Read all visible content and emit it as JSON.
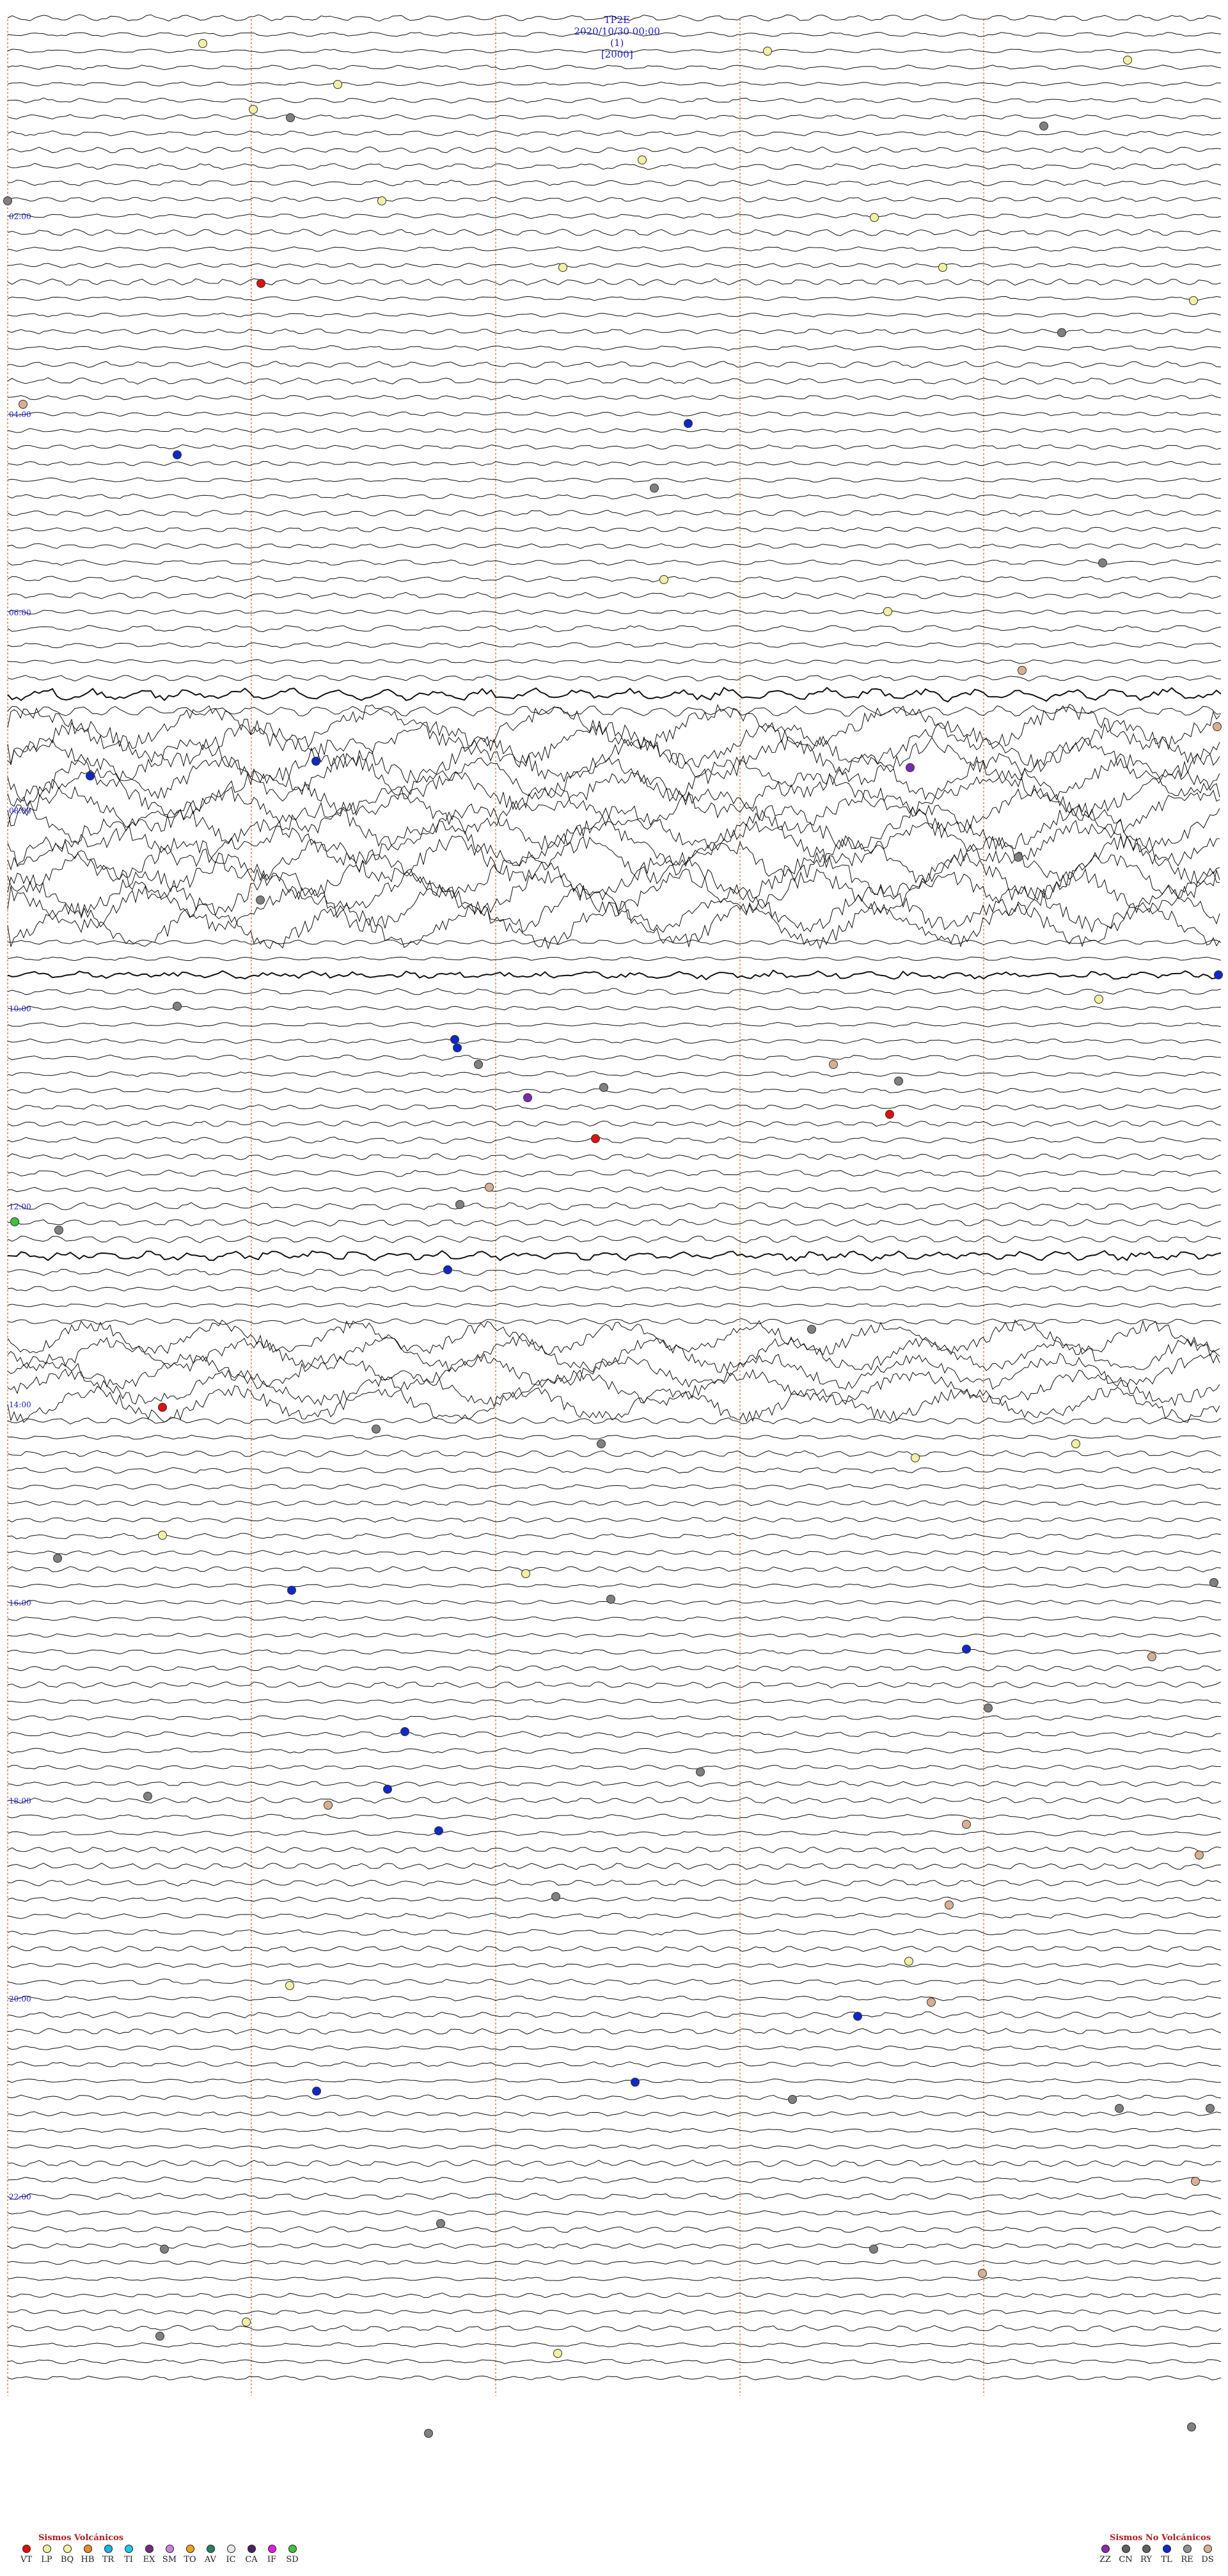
{
  "header": {
    "station": "TP2E",
    "datetime": "2020/10/30 00:00",
    "index": "(1)",
    "scale": "[2000]"
  },
  "chart_data": {
    "type": "helicorder",
    "time_labels": [
      "02:00",
      "04:00",
      "06:00",
      "08:00",
      "10:00",
      "12:00",
      "14:00",
      "16:00",
      "18:00",
      "20:00",
      "22:00"
    ],
    "colors": {
      "trace": "#111111",
      "minute_grid": "#e07a40",
      "label": "#1a1ad0",
      "event_gray": "#808080",
      "event_yellow": "#f3f0a0",
      "event_blue": "#1028c8",
      "event_red": "#e01010",
      "event_purple": "#7a2ab0",
      "event_tan": "#d8b090"
    }
  },
  "legend": {
    "volcanic_title": "Sismos Volcánicos",
    "volcanic": [
      {
        "code": "VT",
        "color": "#e01010"
      },
      {
        "code": "LP",
        "color": "#f5f0a0"
      },
      {
        "code": "BQ",
        "color": "#f5f0a0"
      },
      {
        "code": "HB",
        "color": "#e88a2a"
      },
      {
        "code": "TR",
        "color": "#20b0e0"
      },
      {
        "code": "TI",
        "color": "#20c8e8"
      },
      {
        "code": "EX",
        "color": "#7a2a80"
      },
      {
        "code": "SM",
        "color": "#d080e0"
      },
      {
        "code": "TO",
        "color": "#f0a020"
      },
      {
        "code": "AV",
        "color": "#2a8060"
      },
      {
        "code": "IC",
        "color": "#e8e8e8"
      },
      {
        "code": "CA",
        "color": "#4a2060"
      },
      {
        "code": "IF",
        "color": "#e020e0"
      },
      {
        "code": "SD",
        "color": "#40c040"
      }
    ],
    "nonvolcanic_title": "Sismos No Volcánicos",
    "nonvolcanic": [
      {
        "code": "ZZ",
        "color": "#8a2ab0"
      },
      {
        "code": "CN",
        "color": "#606060"
      },
      {
        "code": "RY",
        "color": "#606060"
      },
      {
        "code": "TL",
        "color": "#1028c8"
      },
      {
        "code": "RE",
        "color": "#909090"
      },
      {
        "code": "DS",
        "color": "#d8b090"
      }
    ]
  }
}
